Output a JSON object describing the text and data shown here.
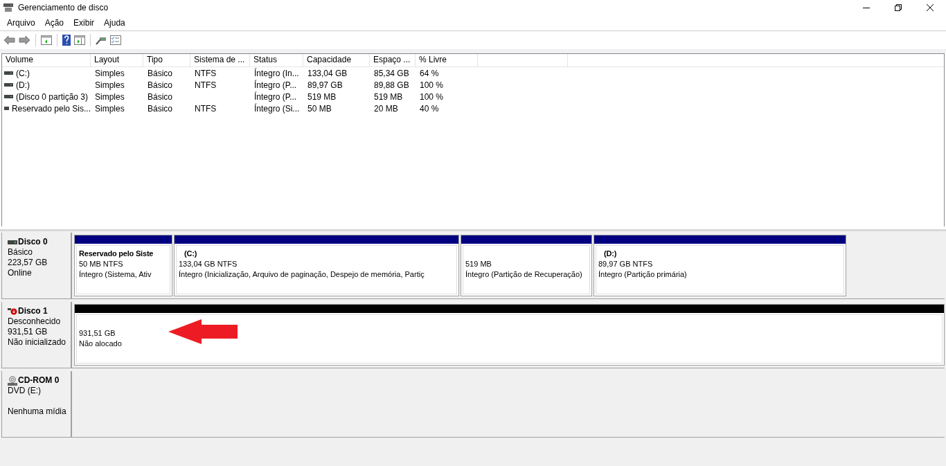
{
  "window": {
    "title": "Gerenciamento de disco"
  },
  "menu": [
    "Arquivo",
    "Ação",
    "Exibir",
    "Ajuda"
  ],
  "volume_table": {
    "columns": [
      "Volume",
      "Layout",
      "Tipo",
      "Sistema de ...",
      "Status",
      "Capacidade",
      "Espaço ...",
      "% Livre"
    ],
    "rows": [
      [
        "(C:)",
        "Simples",
        "Básico",
        "NTFS",
        "Íntegro (In...",
        "133,04 GB",
        "85,34 GB",
        "64 %"
      ],
      [
        "(D:)",
        "Simples",
        "Básico",
        "NTFS",
        "Íntegro (P...",
        "89,97 GB",
        "89,88 GB",
        "100 %"
      ],
      [
        "(Disco 0 partição 3)",
        "Simples",
        "Básico",
        null,
        "Íntegro (P...",
        "519 MB",
        "519 MB",
        "100 %"
      ],
      [
        "Reservado pelo Sis...",
        "Simples",
        "Básico",
        "NTFS",
        "Íntegro (Si...",
        "50 MB",
        "20 MB",
        "40 %"
      ]
    ]
  },
  "disks": [
    {
      "name": "Disco 0",
      "kind": "disk",
      "type": "Básico",
      "size": "223,57 GB",
      "status": "Online",
      "partitions": [
        {
          "label": "Reservado pelo Siste",
          "lines": [
            "50 MB NTFS",
            "Íntegro (Sistema, Ativ"
          ],
          "color": "#000080"
        },
        {
          "label": "(C:)",
          "lines": [
            "133,04 GB NTFS",
            "Íntegro (Inicialização, Arquivo de paginação, Despejo de memória, Partiç"
          ],
          "color": "#000080"
        },
        {
          "lines": [
            "519 MB",
            "Íntegro (Partição de Recuperação)"
          ],
          "color": "#000080"
        },
        {
          "label": "(D:)",
          "lines": [
            "89,97 GB NTFS",
            "Íntegro (Partição primária)"
          ],
          "color": "#000080"
        }
      ]
    },
    {
      "name": "Disco 1",
      "kind": "disk-error",
      "type": "Desconhecido",
      "size": "931,51 GB",
      "status": "Não inicializado",
      "partitions": [
        {
          "lines": [
            "931,51 GB",
            "Não alocado"
          ],
          "color": "#000000"
        }
      ]
    },
    {
      "name": "CD-ROM 0",
      "kind": "cdrom",
      "type": "DVD (E:)",
      "status": "Nenhuma mídia"
    }
  ]
}
